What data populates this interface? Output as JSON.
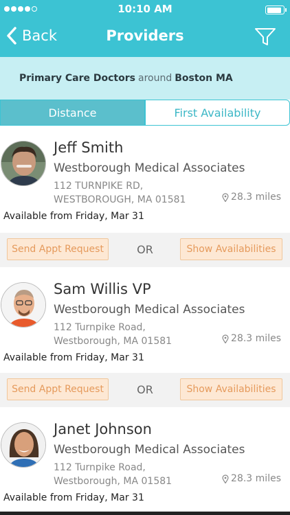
{
  "status_bar": {
    "time": "10:10 AM",
    "battery_level": 0.9
  },
  "nav": {
    "back_label": "Back",
    "title": "Providers",
    "filter_icon": "filter-icon"
  },
  "search": {
    "specialty": "Primary Care Doctors",
    "around": "around",
    "location": "Boston MA"
  },
  "tabs": {
    "distance": "Distance",
    "availability": "First Availability",
    "active": "distance"
  },
  "providers": [
    {
      "name": "Jeff Smith",
      "practice": "Westborough Medical Associates",
      "address1": "112 TURNPIKE RD,",
      "address2": "WESTBOROUGH, MA 01581",
      "distance": "28.3 miles",
      "availability": "Available from Friday, Mar 31"
    },
    {
      "name": "Sam Willis VP",
      "practice": "Westborough Medical Associates",
      "address1": "112 Turnpike Road,",
      "address2": "Westborough, MA 01581",
      "distance": "28.3 miles",
      "availability": "Available from Friday, Mar 31"
    },
    {
      "name": "Janet Johnson",
      "practice": "Westborough Medical Associates",
      "address1": "112 Turnpike Road,",
      "address2": "Westborough, MA 01581",
      "distance": "28.3 miles",
      "availability": "Available from Friday, Mar 31"
    }
  ],
  "actions": {
    "request": "Send Appt Request",
    "or": "OR",
    "show": "Show Availabilities"
  },
  "colors": {
    "accent": "#3cc3d3",
    "banner": "#c7eff3",
    "button_bg": "#fde8d4",
    "button_text": "#e59a5c"
  }
}
